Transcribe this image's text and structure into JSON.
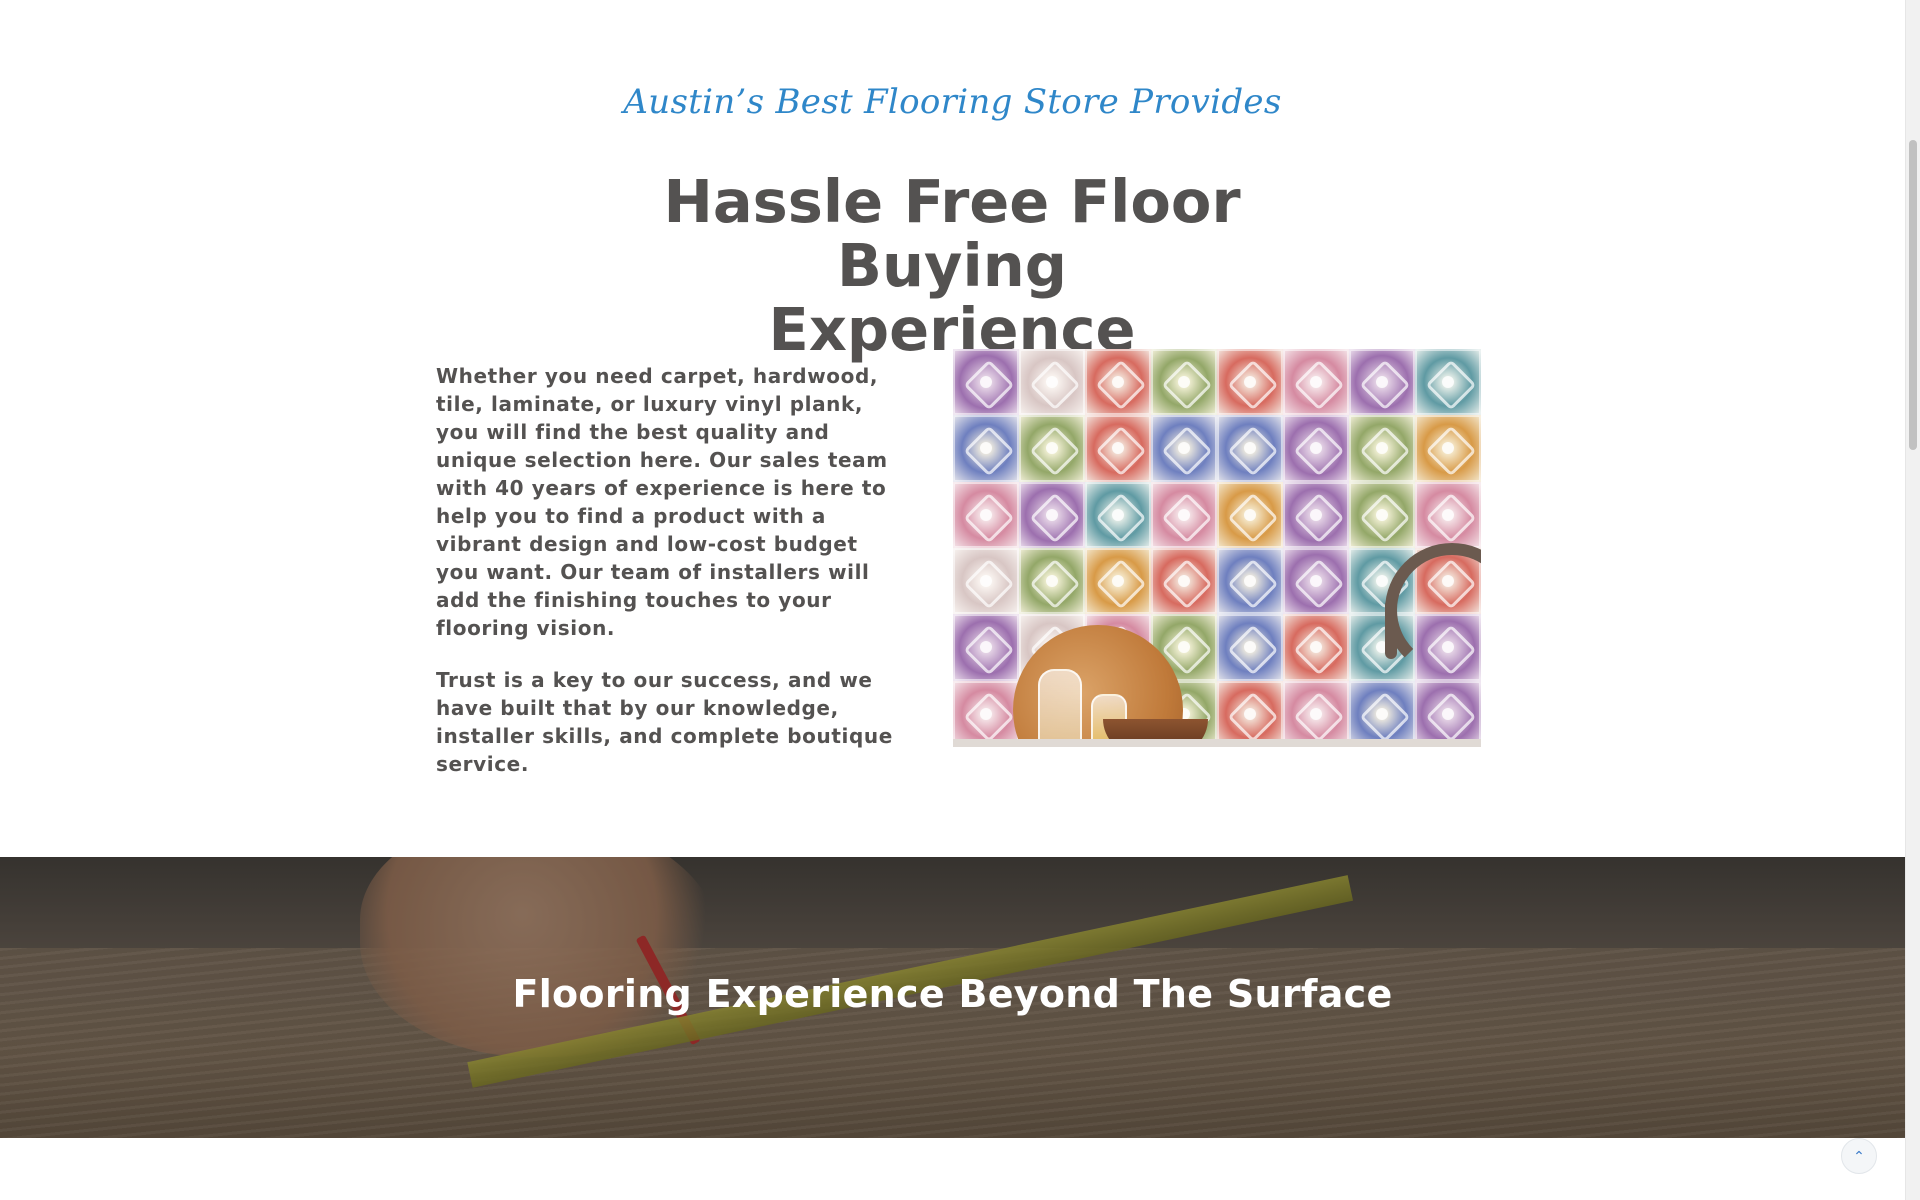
{
  "intro": {
    "eyebrow": "Austin’s Best Flooring Store Provides",
    "headline_line1": "Hassle Free Floor Buying",
    "headline_line2": "Experience",
    "paragraph1": "Whether you need carpet, hardwood, tile, laminate, or luxury vinyl plank, you will find the best quality and unique selection here. Our sales team with 40 years of experience is here to help you to find a product with a vibrant design and low-cost budget you want. Our team of installers will add the finishing touches to your flooring vision.",
    "paragraph2": "Trust is a key to our success, and we have built that by our knowledge, installer skills, and complete boutique service."
  },
  "banner": {
    "title": "Flooring Experience Beyond The Surface"
  },
  "back_to_top": {
    "icon": "chevron-up-icon",
    "glyph": "⌃"
  },
  "colors": {
    "accent": "#2f87c9",
    "heading": "#545251",
    "banner_text": "#ffffff"
  }
}
